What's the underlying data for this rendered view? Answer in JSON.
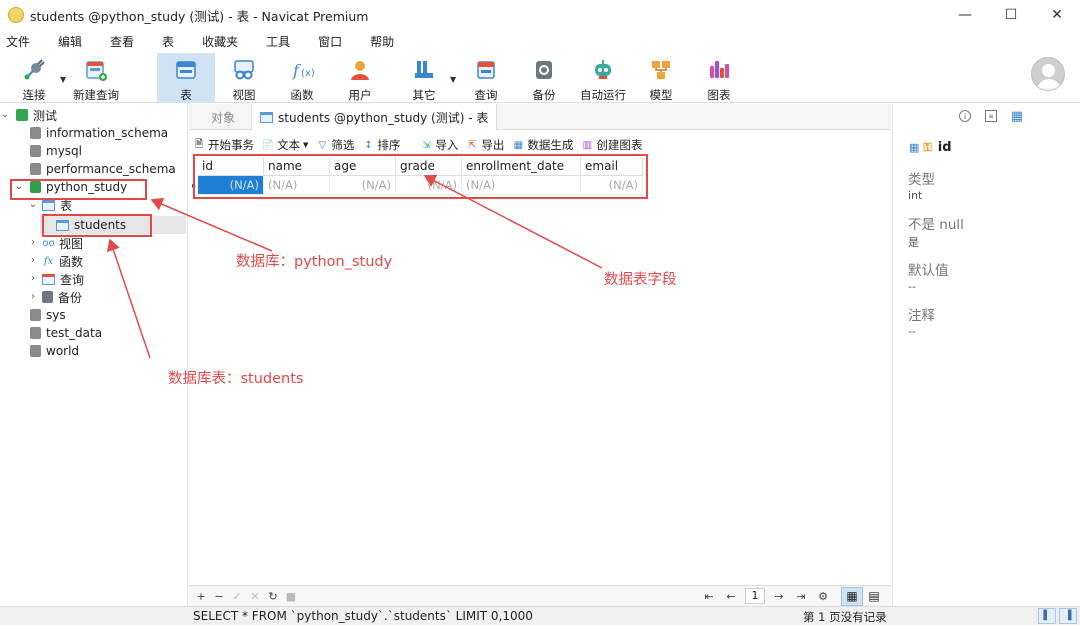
{
  "window": {
    "title": "students @python_study (测试) - 表 - Navicat Premium",
    "controls": [
      "—",
      "☐",
      "✕"
    ]
  },
  "menu": [
    "文件",
    "编辑",
    "查看",
    "表",
    "收藏夹",
    "工具",
    "窗口",
    "帮助"
  ],
  "toolbar": {
    "buttons": [
      {
        "label": "连接",
        "icon": "connect-icon"
      },
      {
        "label": "新建查询",
        "icon": "new-query-icon"
      },
      {
        "label": "表",
        "icon": "table-icon",
        "active": true
      },
      {
        "label": "视图",
        "icon": "view-icon"
      },
      {
        "label": "函数",
        "icon": "function-icon"
      },
      {
        "label": "用户",
        "icon": "user-icon"
      },
      {
        "label": "其它",
        "icon": "other-icon"
      },
      {
        "label": "查询",
        "icon": "query-icon"
      },
      {
        "label": "备份",
        "icon": "backup-icon"
      },
      {
        "label": "自动运行",
        "icon": "automation-icon"
      },
      {
        "label": "模型",
        "icon": "model-icon"
      },
      {
        "label": "图表",
        "icon": "chart-icon"
      }
    ]
  },
  "tree": {
    "connection": "测试",
    "databases": [
      "information_schema",
      "mysql",
      "performance_schema",
      "python_study",
      "sys",
      "test_data",
      "world"
    ],
    "open_db_children": [
      "表",
      "视图",
      "函数",
      "查询",
      "备份"
    ],
    "table": "students"
  },
  "tabs": {
    "objects": "对象",
    "active": "students @python_study (测试) - 表"
  },
  "subtoolbar": [
    "开始事务",
    "文本",
    "筛选",
    "排序",
    "导入",
    "导出",
    "数据生成",
    "创建图表"
  ],
  "grid": {
    "columns": [
      "id",
      "name",
      "age",
      "grade",
      "enrollment_date",
      "email"
    ],
    "null_value": "(N/A)"
  },
  "pager": {
    "page": "1"
  },
  "field_info": {
    "field_name": "id",
    "type_label": "类型",
    "type_value": "int",
    "notnull_label": "不是 null",
    "notnull_value": "是",
    "default_label": "默认值",
    "default_value": "--",
    "comment_label": "注释",
    "comment_value": "--"
  },
  "status": {
    "sql": "SELECT * FROM `python_study`.`students` LIMIT 0,1000",
    "page": "第 1 页没有记录"
  },
  "annotations": {
    "database": "数据库：python_study",
    "table": "数据库表：students",
    "fields": "数据表字段"
  },
  "colors": {
    "annotation": "#e24a4a",
    "selection": "#1e7fd4",
    "active_toolbar": "#cfe3f4"
  }
}
